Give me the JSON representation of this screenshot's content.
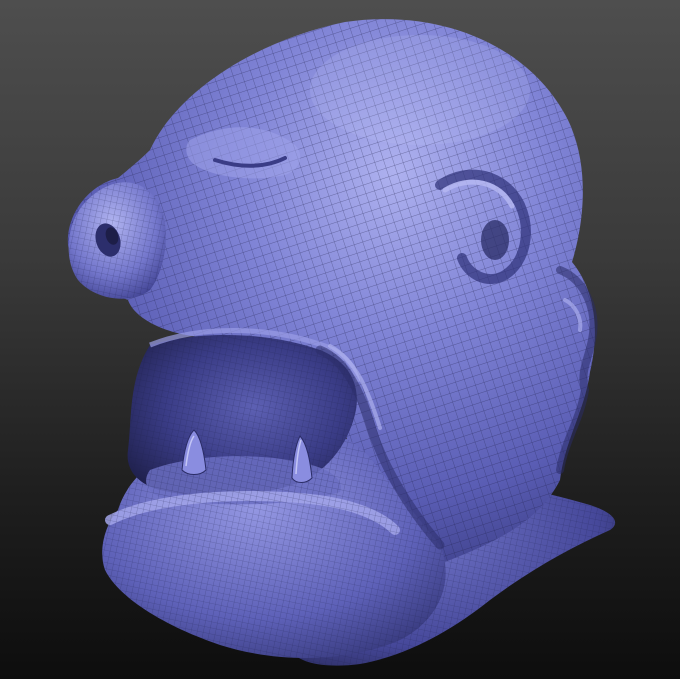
{
  "scene": {
    "subject": "sculpt-mesh",
    "colors": {
      "background_top": "#4e4e4e",
      "background_bottom": "#0d0d0d",
      "mesh_base": "#6e72c4",
      "mesh_highlight": "#a9acec",
      "mesh_shadow": "#2a2c66",
      "mouth_interior": "#23244f",
      "wire": "#1c1d45"
    }
  }
}
